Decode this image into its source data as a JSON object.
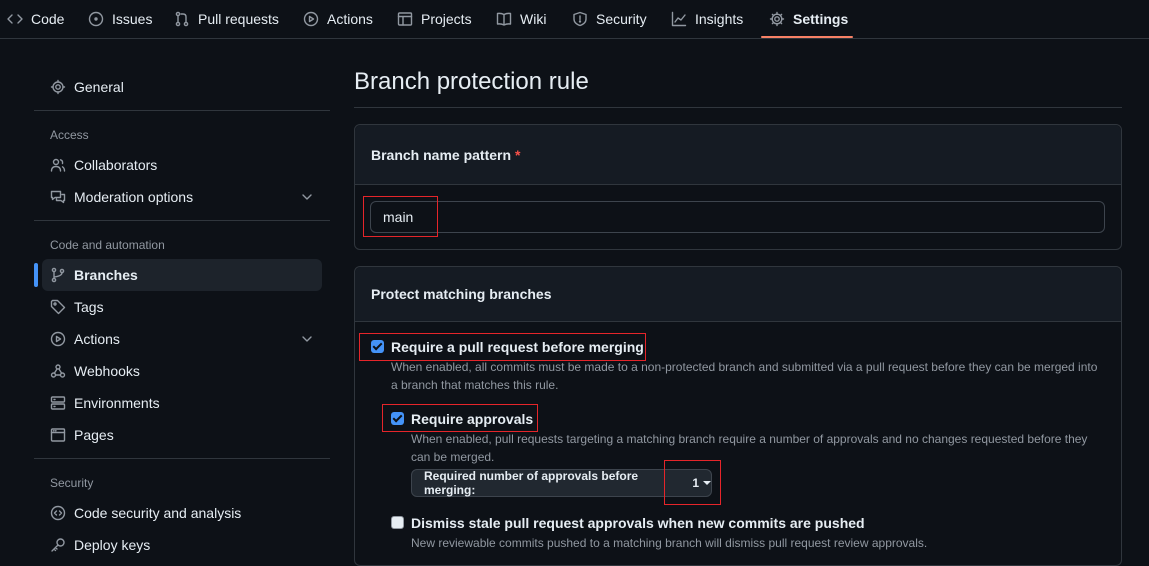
{
  "repo_nav": {
    "tabs": [
      {
        "label": "Code",
        "icon": "code-icon"
      },
      {
        "label": "Issues",
        "icon": "issue-icon"
      },
      {
        "label": "Pull requests",
        "icon": "pull-request-icon"
      },
      {
        "label": "Actions",
        "icon": "play-icon"
      },
      {
        "label": "Projects",
        "icon": "table-icon"
      },
      {
        "label": "Wiki",
        "icon": "book-icon"
      },
      {
        "label": "Security",
        "icon": "shield-icon"
      },
      {
        "label": "Insights",
        "icon": "graph-icon"
      },
      {
        "label": "Settings",
        "icon": "gear-icon",
        "active": true
      }
    ]
  },
  "sidebar": {
    "general": "General",
    "access_heading": "Access",
    "collaborators": "Collaborators",
    "moderation": "Moderation options",
    "code_automation_heading": "Code and automation",
    "branches": "Branches",
    "tags": "Tags",
    "actions": "Actions",
    "webhooks": "Webhooks",
    "environments": "Environments",
    "pages": "Pages",
    "security_heading": "Security",
    "code_security": "Code security and analysis",
    "deploy_keys": "Deploy keys"
  },
  "main": {
    "title": "Branch protection rule",
    "branch_name_section": {
      "label": "Branch name pattern",
      "required_marker": "*",
      "value": "main"
    },
    "protect_section": {
      "heading": "Protect matching branches",
      "require_pr": {
        "label": "Require a pull request before merging",
        "checked": true,
        "description_line1": "When enabled, all commits must be made to a non-protected branch and submitted via a pull request before they can be merged into",
        "description_line2": "a branch that matches this rule."
      },
      "require_approvals": {
        "label": "Require approvals",
        "checked": true,
        "description_line1": "When enabled, pull requests targeting a matching branch require a number of approvals and no changes requested before they",
        "description_line2": "can be merged."
      },
      "approvals_dropdown": {
        "label": "Required number of approvals before merging:",
        "value": "1"
      },
      "dismiss_stale": {
        "label": "Dismiss stale pull request approvals when new commits are pushed",
        "checked": false,
        "description": "New reviewable commits pushed to a matching branch will dismiss pull request review approvals."
      }
    }
  },
  "colors": {
    "background": "#0d1117",
    "accent_blue": "#4493f8",
    "active_tab_underline": "#f78166",
    "highlight_box": "#e5252a"
  }
}
